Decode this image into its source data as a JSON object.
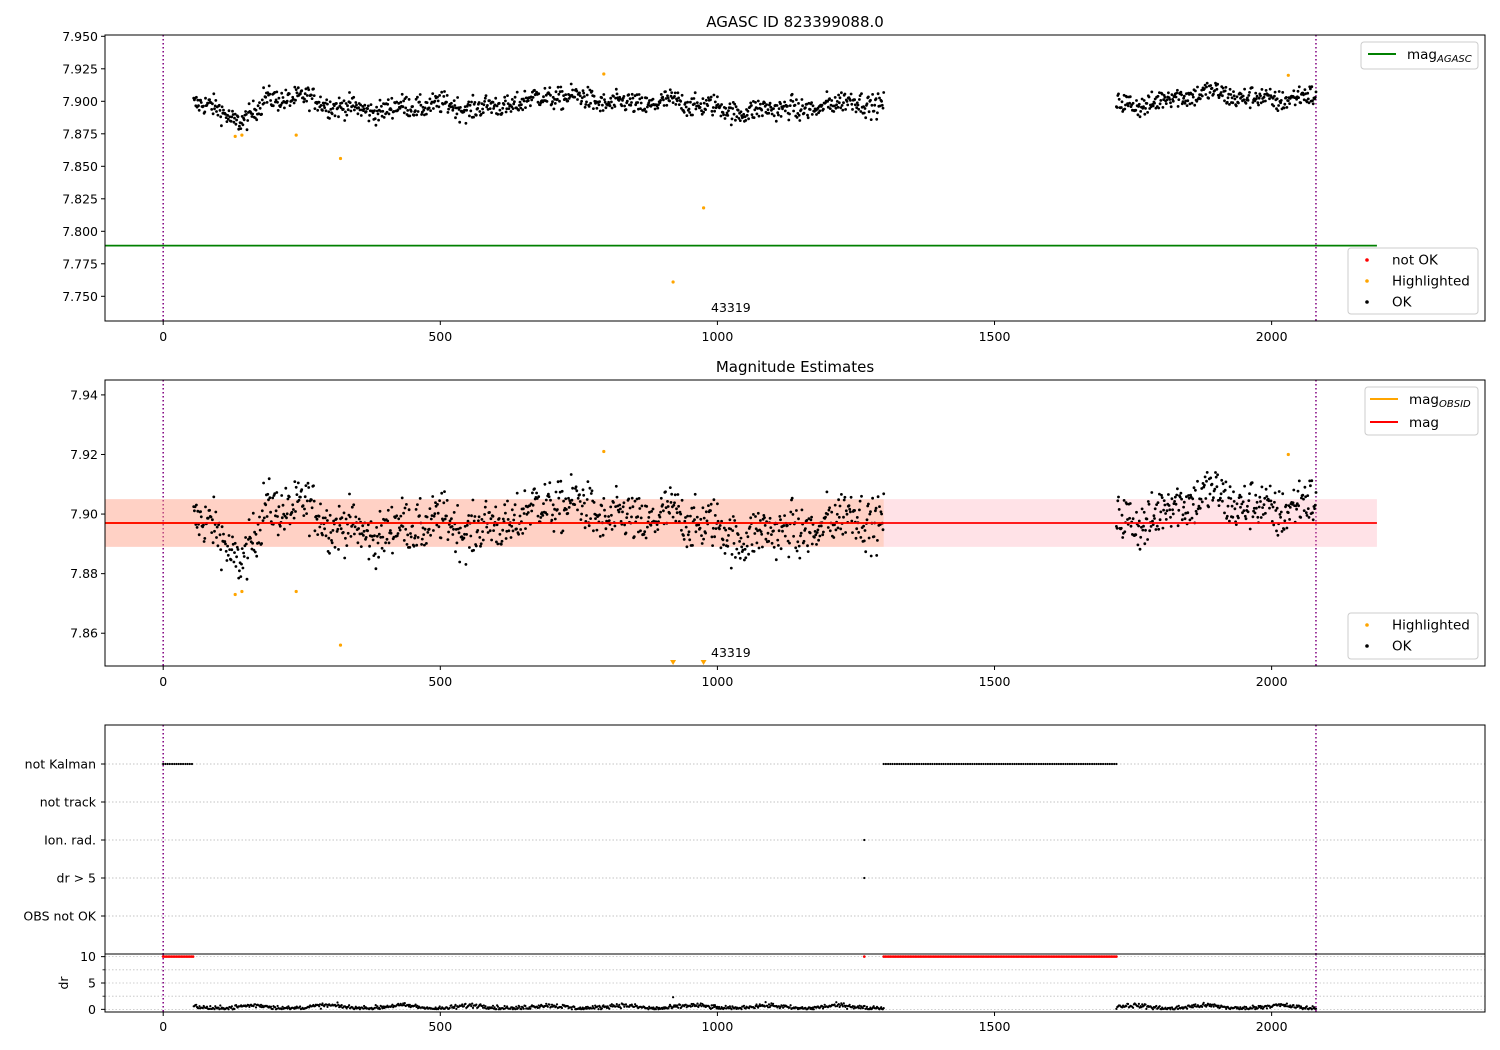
{
  "chart_data": [
    {
      "type": "scatter",
      "title": "AGASC ID 823399088.0",
      "xlim": [
        -105,
        2385
      ],
      "ylim": [
        7.731,
        7.951
      ],
      "xticks": [
        "0",
        "500",
        "1000",
        "1500",
        "2000"
      ],
      "yticks": [
        "7.750",
        "7.775",
        "7.800",
        "7.825",
        "7.850",
        "7.875",
        "7.900",
        "7.925",
        "7.950"
      ],
      "vlines_dotted": [
        0,
        2080
      ],
      "hline": {
        "name": "mag_AGASC",
        "y": 7.789,
        "x_end": 2190
      },
      "annotation": "43319",
      "legend_lines": [
        {
          "label": "mag",
          "subscript": "AGASC",
          "color": "#008000"
        }
      ],
      "legend_points": [
        {
          "label": "not OK",
          "color": "#ff0000"
        },
        {
          "label": "Highlighted",
          "color": "#ffa500"
        },
        {
          "label": "OK",
          "color": "#000000"
        }
      ],
      "ok_segments": [
        {
          "x": [
            55,
            1300
          ],
          "center": 7.898
        },
        {
          "x": [
            1720,
            2080
          ],
          "center": 7.901
        }
      ],
      "highlighted_points": [
        {
          "x": 130,
          "y": 7.873
        },
        {
          "x": 142,
          "y": 7.874
        },
        {
          "x": 240,
          "y": 7.874
        },
        {
          "x": 320,
          "y": 7.856
        },
        {
          "x": 795,
          "y": 7.921
        },
        {
          "x": 920,
          "y": 7.761
        },
        {
          "x": 975,
          "y": 7.818
        },
        {
          "x": 2030,
          "y": 7.92
        }
      ]
    },
    {
      "type": "scatter",
      "title": "Magnitude Estimates",
      "xlim": [
        -105,
        2385
      ],
      "ylim": [
        7.849,
        7.945
      ],
      "xticks": [
        "0",
        "500",
        "1000",
        "1500",
        "2000"
      ],
      "yticks": [
        "7.86",
        "7.88",
        "7.90",
        "7.92",
        "7.94"
      ],
      "vlines_dotted": [
        0,
        2080
      ],
      "mag_line": {
        "name": "mag",
        "y": 7.897,
        "x_end": 2190
      },
      "obsid_line": {
        "name": "mag_OBSID",
        "y": 7.897,
        "x": [
          0,
          1300
        ]
      },
      "band": {
        "y": [
          7.889,
          7.905
        ],
        "x_end": 2190
      },
      "annotation": "43319",
      "legend_lines": [
        {
          "label": "mag",
          "subscript": "OBSID",
          "color": "#ffa500"
        },
        {
          "label": "mag",
          "subscript": "",
          "color": "#ff0000"
        }
      ],
      "legend_points": [
        {
          "label": "Highlighted",
          "color": "#ffa500"
        },
        {
          "label": "OK",
          "color": "#000000"
        }
      ],
      "highlighted_points": [
        {
          "x": 130,
          "y": 7.873
        },
        {
          "x": 142,
          "y": 7.874
        },
        {
          "x": 240,
          "y": 7.874
        },
        {
          "x": 320,
          "y": 7.856
        },
        {
          "x": 795,
          "y": 7.921
        },
        {
          "x": 2030,
          "y": 7.92
        }
      ],
      "offscale_markers": [
        {
          "x": 920
        },
        {
          "x": 975
        }
      ]
    },
    {
      "type": "scatter",
      "categories": [
        "not Kalman",
        "not track",
        "Ion. rad.",
        "dr > 5",
        "OBS not OK"
      ],
      "flag_segments": [
        {
          "flag": "not Kalman",
          "x": [
            0,
            55
          ]
        },
        {
          "flag": "not Kalman",
          "x": [
            1300,
            1720
          ]
        },
        {
          "flag": "Ion. rad.",
          "x": [
            1265,
            1265
          ]
        },
        {
          "flag": "dr > 5",
          "x": [
            1265,
            1265
          ]
        }
      ],
      "vlines_dotted": [
        0,
        2080
      ]
    },
    {
      "type": "scatter",
      "ylabel": "dr",
      "xlim": [
        -105,
        2385
      ],
      "ylim": [
        -0.5,
        10.5
      ],
      "xticks": [
        "0",
        "500",
        "1000",
        "1500",
        "2000"
      ],
      "yticks": [
        "0",
        "5",
        "10"
      ],
      "vlines_dotted": [
        0,
        2080
      ],
      "red_at_ten": [
        [
          0,
          55
        ],
        [
          1265,
          1265
        ],
        [
          1300,
          1720
        ]
      ],
      "dr_segments": [
        [
          55,
          1300
        ],
        [
          1720,
          2080
        ]
      ],
      "dr_outlier": {
        "x": 920,
        "y": 2.3
      }
    }
  ]
}
